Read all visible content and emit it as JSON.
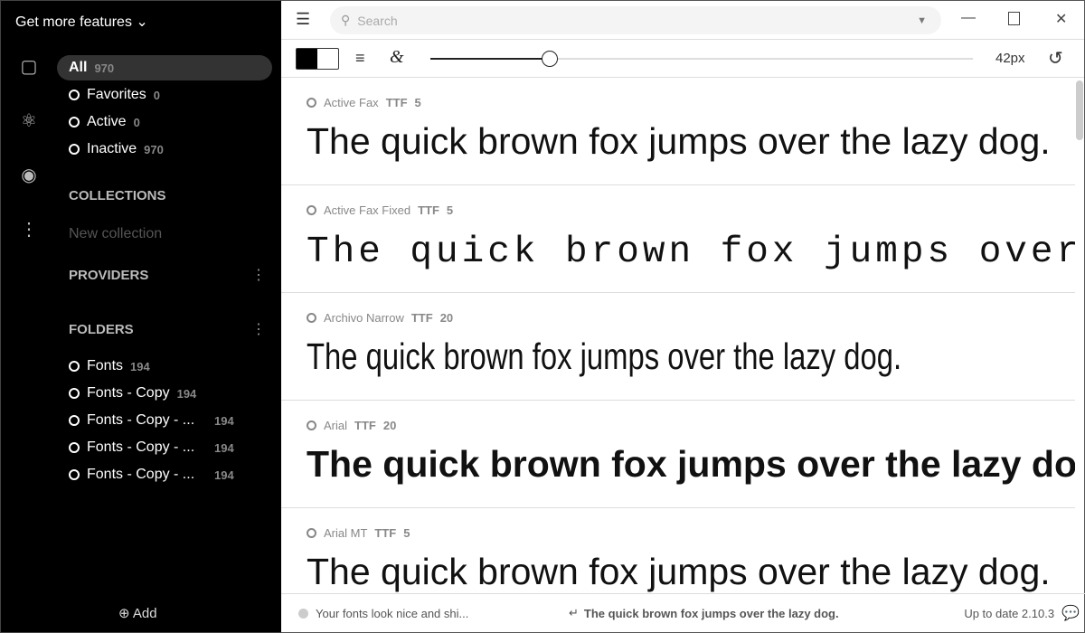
{
  "sidebar": {
    "get_more": "Get more features",
    "nav": [
      {
        "label": "All",
        "count": "970"
      },
      {
        "label": "Favorites",
        "count": "0"
      },
      {
        "label": "Active",
        "count": "0"
      },
      {
        "label": "Inactive",
        "count": "970"
      }
    ],
    "collections": "COLLECTIONS",
    "new_collection": "New collection",
    "providers": "PROVIDERS",
    "folders": "FOLDERS",
    "folder_items": [
      {
        "label": "Fonts",
        "count": "194"
      },
      {
        "label": "Fonts - Copy",
        "count": "194"
      },
      {
        "label": "Fonts - Copy - ...",
        "count": "194"
      },
      {
        "label": "Fonts - Copy - ...",
        "count": "194"
      },
      {
        "label": "Fonts - Copy - ...",
        "count": "194"
      }
    ],
    "add": "Add"
  },
  "search": {
    "placeholder": "Search"
  },
  "toolbar": {
    "size": "42px",
    "slider_percent": 22
  },
  "sample": "The quick brown fox jumps over the lazy dog.",
  "fonts": [
    {
      "name": "Active Fax",
      "type": "TTF",
      "count": "5"
    },
    {
      "name": "Active Fax Fixed",
      "type": "TTF",
      "count": "5"
    },
    {
      "name": "Archivo Narrow",
      "type": "TTF",
      "count": "20"
    },
    {
      "name": "Arial",
      "type": "TTF",
      "count": "20"
    },
    {
      "name": "Arial MT",
      "type": "TTF",
      "count": "5"
    }
  ],
  "status": {
    "left": "Your fonts look nice and shi...",
    "center": "The quick brown fox jumps over the lazy dog.",
    "right": "Up to date 2.10.3"
  }
}
